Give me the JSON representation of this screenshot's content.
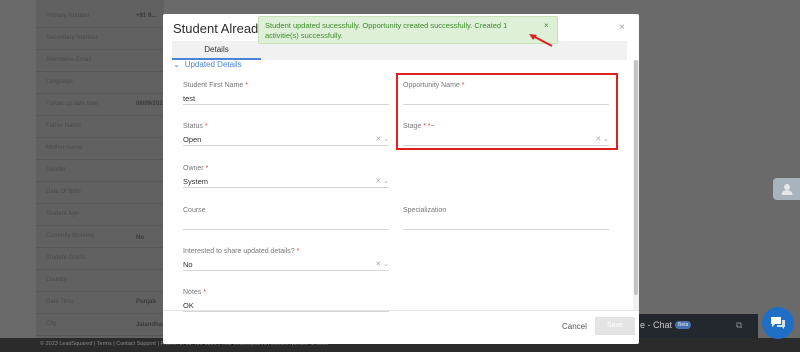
{
  "background": {
    "rows": [
      "Primary Number",
      "Secondary Number",
      "Alternative Email",
      "Language",
      "Follow up date time",
      "Father Name",
      "Mother Name",
      "Gender",
      "Date Of Birth",
      "Student Age",
      "Currently Working",
      "Student Grade",
      "Country",
      "Date Time",
      "City"
    ],
    "values": [
      "+91 9...",
      "",
      "",
      "",
      "08/09/2023 ...",
      "",
      "",
      "",
      "",
      "",
      "No",
      "",
      "",
      "Punjab",
      "Jalandhar"
    ],
    "footer": "© 2023 LeadSquared | Terms | Contact Support | Phone: 0703-400-6800 | Your LeadSquared Account Number is 0000",
    "chat_label": "e - Chat",
    "chat_badge": "Beta"
  },
  "modal": {
    "title": "Student Already",
    "close": "×",
    "tab": "Details",
    "section_title": "Updated Details",
    "fields": {
      "first_name": {
        "label": "Student First Name",
        "required": "*",
        "value": "test"
      },
      "opportunity_name": {
        "label": "Opportunity Name",
        "required": "*",
        "value": ""
      },
      "status": {
        "label": "Status",
        "required": "*",
        "value": "Open"
      },
      "stage": {
        "label": "Stage",
        "required": "* *~",
        "value": ""
      },
      "owner": {
        "label": "Owner",
        "required": "*",
        "value": "System"
      },
      "course": {
        "label": "Course",
        "value": ""
      },
      "specialization": {
        "label": "Specialization",
        "value": ""
      },
      "share": {
        "label": "Interested to share updated details?",
        "required": "*",
        "value": "No"
      },
      "notes": {
        "label": "Notes",
        "required": "*",
        "value": "OK"
      }
    },
    "cancel_label": "Cancel",
    "save_label": "Save"
  },
  "toast": {
    "message": "Student updated sucessfully. Opportunity created successfully. Created 1 activitie(s) successfully.",
    "close": "×"
  },
  "colors": {
    "accent": "#4b86d6",
    "toast_bg": "#dff0d8",
    "toast_text": "#3c8a2c",
    "highlight": "#e02020"
  }
}
